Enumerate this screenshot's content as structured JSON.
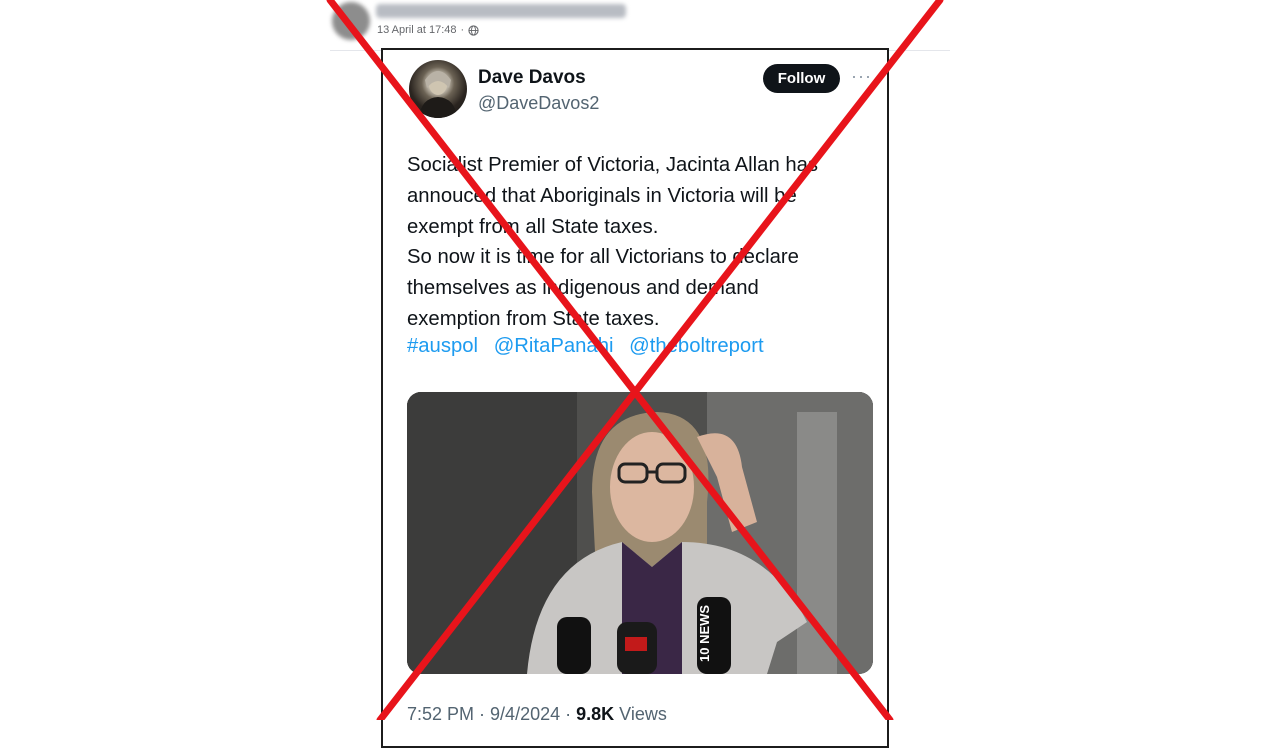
{
  "fb_post": {
    "timestamp": "13 April at 17:48",
    "globe_icon": "globe-icon"
  },
  "tweet": {
    "author_name": "Dave Davos",
    "author_handle": "@DaveDavos2",
    "follow_label": "Follow",
    "more_icon": "more-horizontal-icon",
    "more_glyph": "···",
    "text_lines": [
      "Socialist Premier of Victoria, Jacinta Allan has",
      "annouced that Aboriginals in Victoria will be",
      "exempt from all State taxes.",
      "So now it is time for all Victorians to declare",
      "themselves as indigenous and demand",
      "exemption from State taxes."
    ],
    "tags": [
      "#auspol",
      "@RitaPanahi",
      "@theboltreport"
    ],
    "footer": {
      "time": "7:52 PM",
      "sep1": " · ",
      "date": "9/4/2024",
      "sep2": " · ",
      "views_count": "9.8K",
      "views_label": " Views"
    },
    "photo_mic_label": "10 NEWS"
  },
  "overlay": {
    "color": "#e8141b"
  },
  "colors": {
    "link": "#1d9bf0",
    "text": "#0f1419",
    "muted": "#536471"
  }
}
